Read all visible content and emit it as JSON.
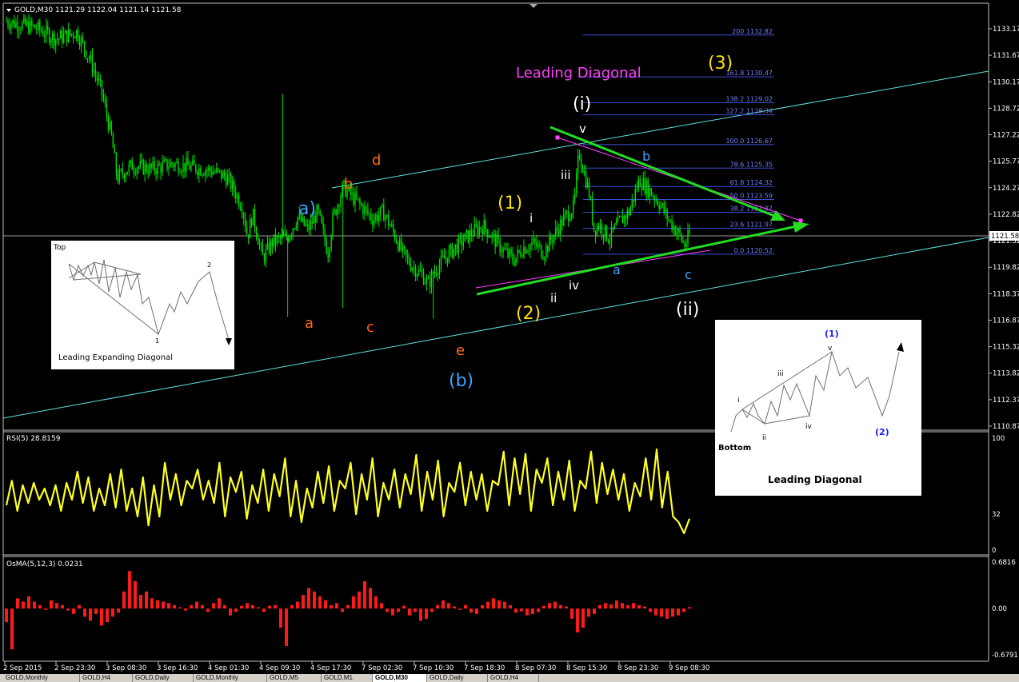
{
  "window": {
    "symbol_line": "GOLD,M30  1121.29 1122.04 1121.14 1121.58",
    "price_tag": "1121.58"
  },
  "colors": {
    "background": "#000000",
    "candle": "#00e000",
    "channel": "#60e0e0",
    "trend": "#22dd22",
    "fib": "#3a4ed6",
    "wedge": "#ff40ff",
    "rsi": "#ffff22",
    "osma": "#ff1a1a",
    "orange_label": "#ff6a10",
    "blue_label": "#3aa2ff",
    "yellow_label": "#ffe000",
    "white_label": "#ffffff",
    "pink_label": "#ff40ff"
  },
  "chart_data": [
    {
      "type": "candlestick",
      "yticks": [
        "1133.17",
        "1131.67",
        "1130.17",
        "1128.72",
        "1127.22",
        "1125.77",
        "1124.27",
        "1122.82",
        "1121.32",
        "1119.82",
        "1118.37",
        "1116.87",
        "1115.32",
        "1113.82",
        "1112.37",
        "1110.87"
      ],
      "ylim": [
        1110.87,
        1133.17
      ],
      "xticks": [
        "2 Sep 2015",
        "2 Sep 23:30",
        "3 Sep 08:30",
        "3 Sep 16:30",
        "4 Sep 01:30",
        "4 Sep 09:30",
        "4 Sep 17:30",
        "7 Sep 02:30",
        "7 Sep 10:30",
        "7 Sep 18:30",
        "8 Sep 07:30",
        "8 Sep 15:30",
        "8 Sep 23:30",
        "9 Sep 08:30"
      ],
      "close_path": [
        [
          0,
          1133.6
        ],
        [
          6,
          1133.2
        ],
        [
          10,
          1132.6
        ],
        [
          14,
          1133.0
        ],
        [
          17,
          1131.2
        ],
        [
          19,
          1129.6
        ],
        [
          21,
          1127.0
        ],
        [
          22,
          1124.8
        ],
        [
          25,
          1125.5
        ],
        [
          29,
          1125.3
        ],
        [
          33,
          1125.6
        ],
        [
          37,
          1125.4
        ],
        [
          41,
          1125.2
        ],
        [
          44,
          1124.8
        ],
        [
          47,
          1123.2
        ],
        [
          48,
          1121.5
        ],
        [
          49,
          1122.8
        ],
        [
          51,
          1120.3
        ],
        [
          53,
          1121.2
        ],
        [
          56,
          1121.5
        ],
        [
          58,
          1122.6
        ],
        [
          60,
          1121.9
        ],
        [
          62,
          1122.9
        ],
        [
          64,
          1120.6
        ],
        [
          65,
          1122.5
        ],
        [
          67,
          1124.3
        ],
        [
          69,
          1123.7
        ],
        [
          71,
          1123.1
        ],
        [
          73,
          1122.5
        ],
        [
          75,
          1122.9
        ],
        [
          77,
          1121.8
        ],
        [
          79,
          1120.5
        ],
        [
          81,
          1119.8
        ],
        [
          83,
          1119.3
        ],
        [
          84,
          1118.8
        ],
        [
          85,
          1119.5
        ],
        [
          87,
          1120.2
        ],
        [
          89,
          1120.8
        ],
        [
          91,
          1121.3
        ],
        [
          93,
          1121.8
        ],
        [
          95,
          1122.1
        ],
        [
          97,
          1121.4
        ],
        [
          99,
          1120.7
        ],
        [
          101,
          1120.2
        ],
        [
          103,
          1120.9
        ],
        [
          105,
          1121.1
        ],
        [
          107,
          1120.6
        ],
        [
          109,
          1121.6
        ],
        [
          111,
          1122.5
        ],
        [
          113,
          1123.2
        ],
        [
          114,
          1126.3
        ],
        [
          116,
          1124.0
        ],
        [
          117,
          1121.9
        ],
        [
          118,
          1122.2
        ],
        [
          120,
          1121.4
        ],
        [
          122,
          1122.3
        ],
        [
          124,
          1122.9
        ],
        [
          126,
          1124.7
        ],
        [
          128,
          1124.1
        ],
        [
          130,
          1123.4
        ],
        [
          132,
          1122.4
        ],
        [
          134,
          1121.6
        ],
        [
          135,
          1121.0
        ],
        [
          136,
          1121.6
        ]
      ],
      "spikes": [
        [
          55,
          1129.5
        ],
        [
          85,
          1116.9
        ],
        [
          56,
          1117.0
        ],
        [
          67,
          1117.5
        ]
      ]
    },
    {
      "type": "line",
      "header": "RSI(5) 28.8159",
      "yticks": [
        "100",
        "32",
        "0"
      ],
      "ylim": [
        0,
        100
      ],
      "series": [
        {
          "values": [
            40,
            62,
            35,
            58,
            42,
            60,
            45,
            55,
            40,
            58,
            35,
            60,
            45,
            70,
            42,
            65,
            35,
            55,
            40,
            68,
            38,
            72,
            35,
            55,
            30,
            65,
            22,
            58,
            30,
            78,
            45,
            68,
            40,
            62,
            55,
            72,
            45,
            62,
            42,
            78,
            30,
            65,
            52,
            70,
            28,
            58,
            42,
            72,
            35,
            68,
            48,
            82,
            30,
            62,
            25,
            55,
            38,
            70,
            42,
            75,
            35,
            62,
            55,
            78,
            32,
            68,
            45,
            82,
            30,
            60,
            45,
            72,
            38,
            68,
            50,
            85,
            35,
            70,
            45,
            80,
            30,
            60,
            52,
            78,
            40,
            70,
            45,
            68,
            35,
            62,
            58,
            88,
            40,
            82,
            50,
            86,
            35,
            72,
            60,
            82,
            40,
            70,
            45,
            80,
            35,
            62,
            55,
            88,
            42,
            78,
            50,
            72,
            45,
            68,
            35,
            60,
            48,
            82,
            45,
            90,
            38,
            70,
            30,
            25,
            15,
            28
          ]
        }
      ]
    },
    {
      "type": "bar",
      "header": "OsMA(5,12,3) 0.0231",
      "yticks": [
        "0.6816",
        "0.00",
        "-0.6791"
      ],
      "ylim": [
        -0.6791,
        0.6816
      ],
      "series": [
        {
          "values": [
            -0.2,
            -0.6,
            0.15,
            0.1,
            0.18,
            0.1,
            0.05,
            -0.02,
            0.12,
            0.08,
            0.05,
            -0.03,
            -0.08,
            0.05,
            -0.12,
            -0.18,
            -0.08,
            -0.25,
            -0.2,
            -0.12,
            -0.06,
            0.25,
            0.55,
            0.4,
            0.2,
            0.25,
            0.15,
            0.12,
            0.1,
            0.08,
            0.05,
            0.02,
            -0.03,
            0.05,
            0.1,
            0.05,
            -0.05,
            0.08,
            0.15,
            0.05,
            -0.1,
            -0.05,
            0.04,
            0.08,
            0.05,
            0.02,
            -0.05,
            0.04,
            0.05,
            -0.28,
            -0.55,
            0.05,
            0.1,
            0.2,
            0.3,
            0.25,
            0.18,
            0.12,
            0.05,
            0.08,
            -0.05,
            0.05,
            0.18,
            0.25,
            0.4,
            0.3,
            0.18,
            0.08,
            -0.05,
            -0.1,
            -0.05,
            0.04,
            -0.1,
            -0.05,
            -0.18,
            -0.15,
            -0.05,
            0.05,
            0.12,
            0.08,
            0.03,
            -0.02,
            0.05,
            -0.06,
            -0.08,
            0.05,
            0.1,
            0.15,
            0.12,
            0.1,
            0.05,
            -0.06,
            -0.04,
            -0.1,
            -0.08,
            -0.05,
            0.04,
            0.08,
            0.1,
            0.05,
            0.03,
            -0.15,
            -0.35,
            -0.28,
            -0.12,
            -0.08,
            0.05,
            0.08,
            0.06,
            0.12,
            0.08,
            0.05,
            0.08,
            0.05,
            0.03,
            -0.05,
            -0.1,
            -0.12,
            -0.15,
            -0.12,
            -0.1,
            -0.05,
            0.02
          ]
        }
      ]
    }
  ],
  "fib_levels": [
    {
      "pct": "200",
      "price": "1132.82",
      "value": 1132.82
    },
    {
      "pct": "161.8",
      "price": "1130.47",
      "value": 1130.47
    },
    {
      "pct": "138.2",
      "price": "1129.02",
      "value": 1129.02
    },
    {
      "pct": "127.2",
      "price": "1128.34",
      "value": 1128.34
    },
    {
      "pct": "100.0",
      "price": "1126.67",
      "value": 1126.67
    },
    {
      "pct": "78.6",
      "price": "1125.35",
      "value": 1125.35
    },
    {
      "pct": "61.8",
      "price": "1124.32",
      "value": 1124.32
    },
    {
      "pct": "50.0",
      "price": "1123.59",
      "value": 1123.59
    },
    {
      "pct": "38.2",
      "price": "1122.87",
      "value": 1122.87
    },
    {
      "pct": "23.6",
      "price": "1121.97",
      "value": 1121.97
    },
    {
      "pct": "0.0",
      "price": "1120.52",
      "value": 1120.52
    }
  ],
  "annotations": {
    "leading_diagonal": "Leading Diagonal",
    "three": "(3)",
    "i_wave": "(i)",
    "ii_wave": "(ii)",
    "one": "(1)",
    "two": "(2)",
    "a_paren": "a)",
    "b_paren": "(b)",
    "v": "v",
    "iii": "iii",
    "i_small": "i",
    "ii_small": "ii",
    "iv_small": "iv",
    "a_orange": "a",
    "b_orange": "b",
    "c_orange": "c",
    "d_orange": "d",
    "e_orange": "e",
    "a_blue": "a",
    "b_blue": "b",
    "c_blue": "c"
  },
  "insets": {
    "expanding": {
      "title": "Leading Expanding Diagonal",
      "top": "Top",
      "one": "1",
      "two": "2"
    },
    "leading": {
      "title": "Leading Diagonal",
      "bottom": "Bottom",
      "one": "(1)",
      "two": "(2)",
      "i": "i",
      "ii": "ii",
      "iii": "iii",
      "iv": "iv",
      "v": "v"
    }
  },
  "tabs": [
    "GOLD,Monthly",
    "GOLD,H4",
    "GOLD,Daily",
    "GOLD,Monthly",
    "GOLD,M5",
    "GOLD,M1",
    "GOLD,M30",
    "GOLD,Daily",
    "GOLD,H4"
  ]
}
